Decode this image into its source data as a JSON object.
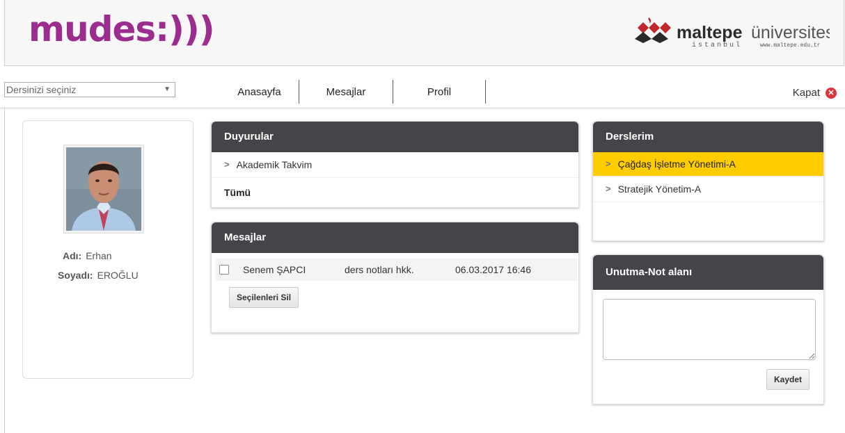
{
  "header": {
    "logo_text": "mudes:)))",
    "partner_logo": {
      "name": "maltepe",
      "suffix": "üniversitesi",
      "city": "istanbul",
      "url": "www.maltepe.edu.tr"
    }
  },
  "nav": {
    "course_select_placeholder": "Dersinizi seçiniz",
    "items": [
      {
        "label": "Anasayfa"
      },
      {
        "label": "Mesajlar"
      },
      {
        "label": "Profil"
      }
    ],
    "close_label": "Kapat"
  },
  "profile": {
    "name_label": "Adı:",
    "name_value": "Erhan",
    "surname_label": "Soyadı:",
    "surname_value": "EROĞLU"
  },
  "announcements": {
    "title": "Duyurular",
    "items": [
      {
        "label": "Akademik Takvim"
      }
    ],
    "all_label": "Tümü"
  },
  "messages": {
    "title": "Mesajlar",
    "rows": [
      {
        "sender": "Senem ŞAPCI",
        "subject": "ders notları hkk.",
        "date": "06.03.2017 16:46"
      }
    ],
    "delete_button": "Seçilenleri Sil"
  },
  "courses": {
    "title": "Derslerim",
    "items": [
      {
        "label": "Çağdaş İşletme Yönetimi-A",
        "active": true
      },
      {
        "label": "Stratejik Yönetim-A",
        "active": false
      }
    ]
  },
  "notes": {
    "title": "Unutma-Not alanı",
    "value": "",
    "save_button": "Kaydet"
  },
  "colors": {
    "brand_purple": "#9b2d8e",
    "panel_header": "#434549",
    "active_row": "#ffcc00",
    "close_red": "#d9363e"
  }
}
